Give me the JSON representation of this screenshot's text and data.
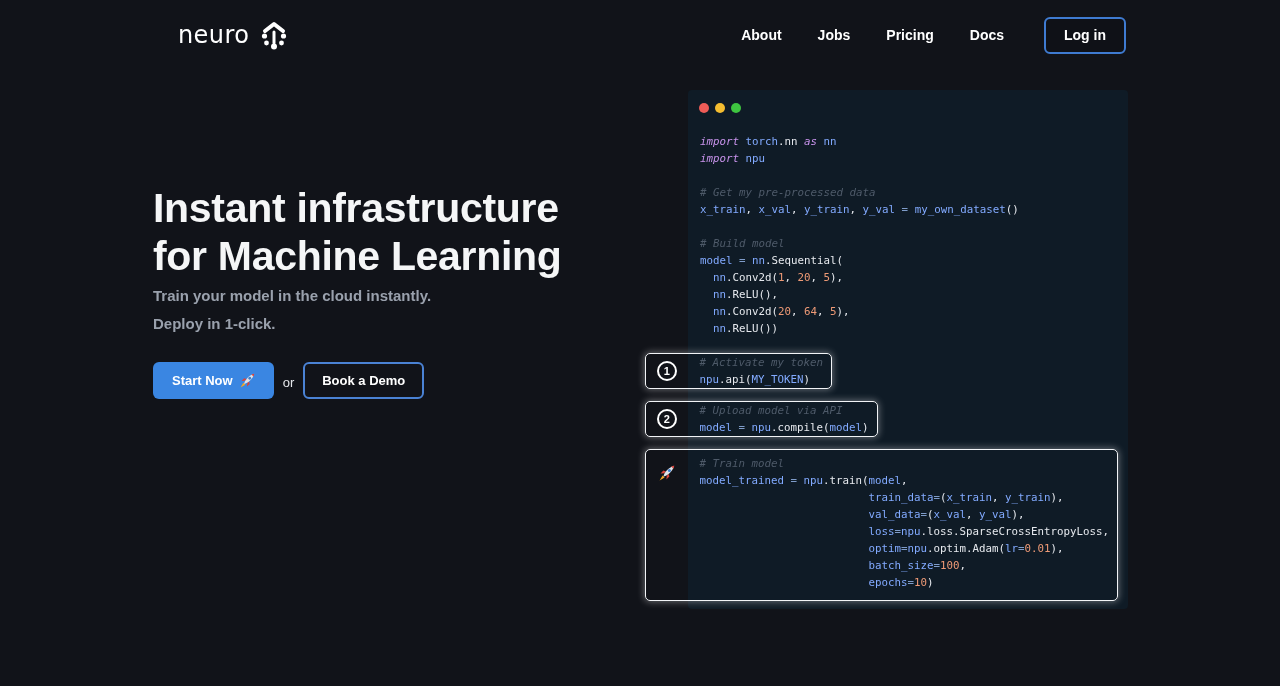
{
  "header": {
    "logo": "neuro",
    "nav_links": [
      "About",
      "Jobs",
      "Pricing",
      "Docs"
    ],
    "login_button": "Log in"
  },
  "hero": {
    "title_lines": [
      "Instant infrastructure",
      "for Machine Learning"
    ],
    "subtitle_lines": [
      "Train your model in the cloud instantly.",
      "Deploy in 1-click."
    ],
    "primary_button": "Start Now",
    "separator": "or",
    "secondary_button": "Book a Demo"
  },
  "code_window": {
    "window_controls": [
      {
        "color": "#ee5c57"
      },
      {
        "color": "#f4bd30"
      },
      {
        "color": "#3ec540"
      }
    ],
    "blocks": [
      {
        "lines": [
          [
            {
              "text": "import ",
              "kind": "keyword"
            },
            {
              "text": "torch",
              "kind": "name"
            },
            {
              "text": ".nn ",
              "kind": "plain"
            },
            {
              "text": "as ",
              "kind": "keyword"
            },
            {
              "text": "nn",
              "kind": "name"
            }
          ],
          [
            {
              "text": "import ",
              "kind": "keyword"
            },
            {
              "text": "npu",
              "kind": "name"
            }
          ]
        ]
      },
      {
        "lines": [
          [
            {
              "text": "# Get my pre-processed data",
              "kind": "comment"
            }
          ],
          [
            {
              "text": "x_train",
              "kind": "name"
            },
            {
              "text": ", ",
              "kind": "plain"
            },
            {
              "text": "x_val",
              "kind": "name"
            },
            {
              "text": ", ",
              "kind": "plain"
            },
            {
              "text": "y_train",
              "kind": "name"
            },
            {
              "text": ", ",
              "kind": "plain"
            },
            {
              "text": "y_val",
              "kind": "name"
            },
            {
              "text": " = ",
              "kind": "op"
            },
            {
              "text": "my_own_dataset",
              "kind": "name"
            },
            {
              "text": "()",
              "kind": "plain"
            }
          ]
        ]
      },
      {
        "lines": [
          [
            {
              "text": "# Build model",
              "kind": "comment"
            }
          ],
          [
            {
              "text": "model",
              "kind": "name"
            },
            {
              "text": " = ",
              "kind": "op"
            },
            {
              "text": "nn",
              "kind": "name"
            },
            {
              "text": ".Sequential(",
              "kind": "plain"
            }
          ],
          [
            {
              "text": "  nn",
              "kind": "name"
            },
            {
              "text": ".Conv2d(",
              "kind": "plain"
            },
            {
              "text": "1",
              "kind": "number"
            },
            {
              "text": ", ",
              "kind": "plain"
            },
            {
              "text": "20",
              "kind": "number"
            },
            {
              "text": ", ",
              "kind": "plain"
            },
            {
              "text": "5",
              "kind": "number"
            },
            {
              "text": "),",
              "kind": "plain"
            }
          ],
          [
            {
              "text": "  nn",
              "kind": "name"
            },
            {
              "text": ".ReLU(),",
              "kind": "plain"
            }
          ],
          [
            {
              "text": "  nn",
              "kind": "name"
            },
            {
              "text": ".Conv2d(",
              "kind": "plain"
            },
            {
              "text": "20",
              "kind": "number"
            },
            {
              "text": ", ",
              "kind": "plain"
            },
            {
              "text": "64",
              "kind": "number"
            },
            {
              "text": ", ",
              "kind": "plain"
            },
            {
              "text": "5",
              "kind": "number"
            },
            {
              "text": "),",
              "kind": "plain"
            }
          ],
          [
            {
              "text": "  nn",
              "kind": "name"
            },
            {
              "text": ".ReLU())",
              "kind": "plain"
            }
          ]
        ]
      }
    ],
    "steps": [
      {
        "kind": "number",
        "number": "1",
        "lines": [
          [
            {
              "text": "# Activate my token",
              "kind": "comment"
            }
          ],
          [
            {
              "text": "npu",
              "kind": "name"
            },
            {
              "text": ".api(",
              "kind": "plain"
            },
            {
              "text": "MY_TOKEN",
              "kind": "name"
            },
            {
              "text": ")",
              "kind": "plain"
            }
          ]
        ]
      },
      {
        "kind": "number",
        "number": "2",
        "lines": [
          [
            {
              "text": "# Upload model via API",
              "kind": "comment"
            }
          ],
          [
            {
              "text": "model",
              "kind": "name"
            },
            {
              "text": " = ",
              "kind": "op"
            },
            {
              "text": "npu",
              "kind": "name"
            },
            {
              "text": ".compile(",
              "kind": "plain"
            },
            {
              "text": "model",
              "kind": "name"
            },
            {
              "text": ")",
              "kind": "plain"
            }
          ]
        ]
      },
      {
        "kind": "rocket",
        "lines": [
          [
            {
              "text": "# Train model",
              "kind": "comment"
            }
          ],
          [
            {
              "text": "model_trained",
              "kind": "name"
            },
            {
              "text": " = ",
              "kind": "op"
            },
            {
              "text": "npu",
              "kind": "name"
            },
            {
              "text": ".train(",
              "kind": "plain"
            },
            {
              "text": "model",
              "kind": "name"
            },
            {
              "text": ",",
              "kind": "plain"
            }
          ],
          [
            {
              "text": "                          train_data",
              "kind": "name"
            },
            {
              "text": "=",
              "kind": "op"
            },
            {
              "text": "(",
              "kind": "plain"
            },
            {
              "text": "x_train",
              "kind": "name"
            },
            {
              "text": ", ",
              "kind": "plain"
            },
            {
              "text": "y_train",
              "kind": "name"
            },
            {
              "text": "),",
              "kind": "plain"
            }
          ],
          [
            {
              "text": "                          val_data",
              "kind": "name"
            },
            {
              "text": "=",
              "kind": "op"
            },
            {
              "text": "(",
              "kind": "plain"
            },
            {
              "text": "x_val",
              "kind": "name"
            },
            {
              "text": ", ",
              "kind": "plain"
            },
            {
              "text": "y_val",
              "kind": "name"
            },
            {
              "text": "),",
              "kind": "plain"
            }
          ],
          [
            {
              "text": "                          loss",
              "kind": "name"
            },
            {
              "text": "=",
              "kind": "op"
            },
            {
              "text": "npu",
              "kind": "name"
            },
            {
              "text": ".loss.SparseCrossEntropyLoss,",
              "kind": "plain"
            }
          ],
          [
            {
              "text": "                          optim",
              "kind": "name"
            },
            {
              "text": "=",
              "kind": "op"
            },
            {
              "text": "npu",
              "kind": "name"
            },
            {
              "text": ".optim.Adam(",
              "kind": "plain"
            },
            {
              "text": "lr",
              "kind": "name"
            },
            {
              "text": "=",
              "kind": "op"
            },
            {
              "text": "0.01",
              "kind": "number"
            },
            {
              "text": "),",
              "kind": "plain"
            }
          ],
          [
            {
              "text": "                          batch_size",
              "kind": "name"
            },
            {
              "text": "=",
              "kind": "op"
            },
            {
              "text": "100",
              "kind": "number"
            },
            {
              "text": ",",
              "kind": "plain"
            }
          ],
          [
            {
              "text": "                          epochs",
              "kind": "name"
            },
            {
              "text": "=",
              "kind": "op"
            },
            {
              "text": "10",
              "kind": "number"
            },
            {
              "text": ")",
              "kind": "plain"
            }
          ]
        ]
      }
    ]
  }
}
